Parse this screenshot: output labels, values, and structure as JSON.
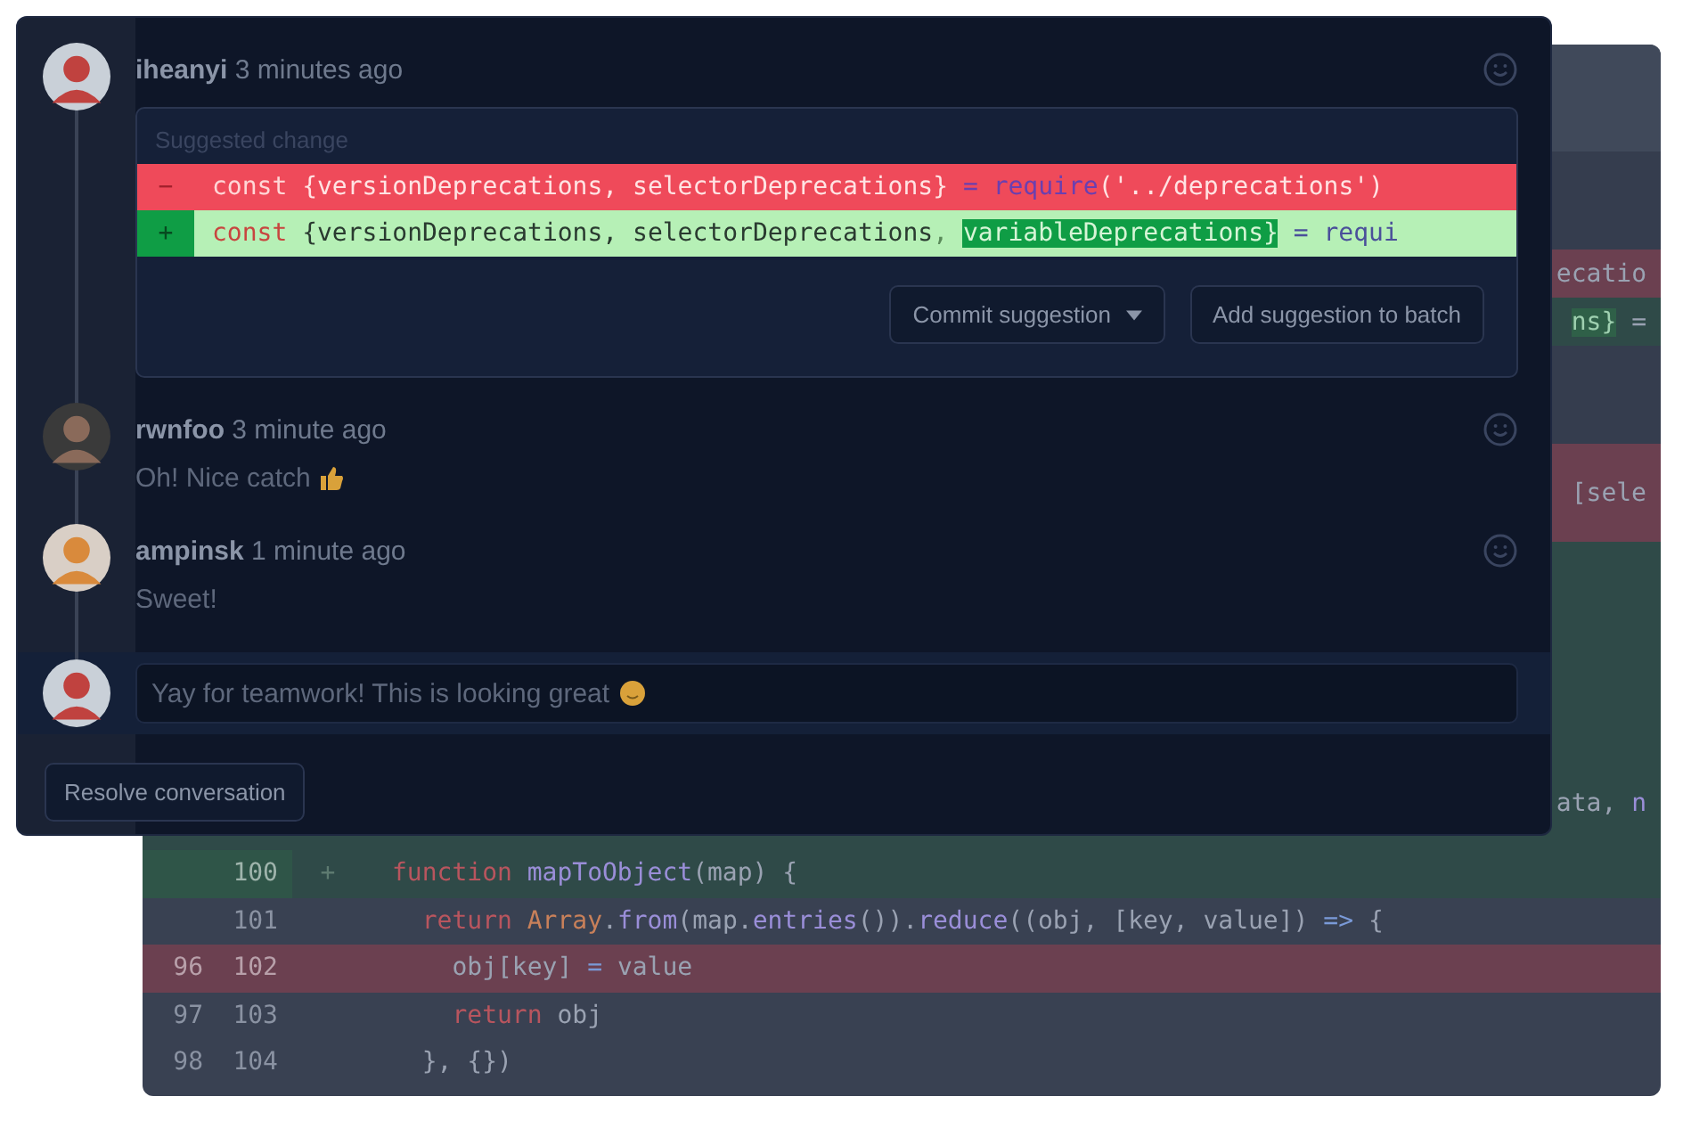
{
  "code_view": {
    "rows": [
      {
        "kind": "head",
        "tokens": []
      },
      {
        "kind": "ctx",
        "tokens": []
      },
      {
        "kind": "del",
        "tokens": [
          {
            "text": "ecatio",
            "kind": "plain"
          }
        ]
      },
      {
        "kind": "add",
        "tokens": [
          {
            "text": "ns}",
            "kind": "highlight"
          },
          {
            "text": " =",
            "kind": "plain"
          }
        ]
      },
      {
        "kind": "ctx",
        "tokens": []
      },
      {
        "kind": "del",
        "tokens": [
          {
            "text": "[sele",
            "kind": "plain"
          }
        ]
      },
      {
        "kind": "add",
        "tokens": []
      },
      {
        "kind": "add",
        "tokens": [
          {
            "text": "ata, ",
            "kind": "plain"
          },
          {
            "text": "n",
            "kind": "func"
          }
        ]
      }
    ],
    "lines": [
      {
        "kind": "add",
        "new": "100",
        "sign": "+",
        "tokens": [
          {
            "text": "function ",
            "kind": "keyword"
          },
          {
            "text": "mapToObject",
            "kind": "func"
          },
          {
            "text": "(map) {",
            "kind": "plain"
          }
        ]
      },
      {
        "kind": "ctx",
        "new": "101",
        "tokens": [
          {
            "text": "  return ",
            "kind": "keyword"
          },
          {
            "text": "Array",
            "kind": "const"
          },
          {
            "text": ".",
            "kind": "plain"
          },
          {
            "text": "from",
            "kind": "func"
          },
          {
            "text": "(map.",
            "kind": "plain"
          },
          {
            "text": "entries",
            "kind": "func"
          },
          {
            "text": "()).",
            "kind": "plain"
          },
          {
            "text": "reduce",
            "kind": "func"
          },
          {
            "text": "((obj, [key, value]) ",
            "kind": "plain"
          },
          {
            "text": "=>",
            "kind": "op"
          },
          {
            "text": " {",
            "kind": "plain"
          }
        ]
      },
      {
        "kind": "del",
        "old": "96",
        "new": "102",
        "tokens": [
          {
            "text": "    obj[key] ",
            "kind": "plain"
          },
          {
            "text": "=",
            "kind": "op"
          },
          {
            "text": " value",
            "kind": "plain"
          }
        ]
      },
      {
        "kind": "ctx",
        "old": "97",
        "new": "103",
        "tokens": [
          {
            "text": "    return ",
            "kind": "keyword"
          },
          {
            "text": "obj",
            "kind": "plain"
          }
        ]
      },
      {
        "kind": "ctx",
        "old": "98",
        "new": "104",
        "tokens": [
          {
            "text": "  }, {})",
            "kind": "plain"
          }
        ]
      }
    ]
  },
  "conversation": {
    "comments": [
      {
        "author": "iheanyi",
        "time": "3 minutes ago",
        "suggestion": {
          "title": "Suggested change",
          "lines": [
            {
              "kind": "del",
              "sign": "−",
              "tokens": [
                {
                  "text": "const ",
                  "kind": "keyword"
                },
                {
                  "text": "{versionDeprecations, selectorDeprecations} ",
                  "kind": "plain"
                },
                {
                  "text": "= ",
                  "kind": "op"
                },
                {
                  "text": "require",
                  "kind": "func"
                },
                {
                  "text": "('../deprecations')",
                  "kind": "plain"
                }
              ]
            },
            {
              "kind": "add",
              "sign": "+",
              "tokens": [
                {
                  "text": "const ",
                  "kind": "keyword"
                },
                {
                  "text": "{versionDeprecations, selectorDeprecations",
                  "kind": "plain"
                },
                {
                  "text": ", ",
                  "kind": "faint"
                },
                {
                  "text": "variableDeprecations}",
                  "kind": "highlight"
                },
                {
                  "text": " = requi",
                  "kind": "op"
                }
              ]
            }
          ],
          "buttons": [
            {
              "label": "Commit suggestion",
              "dropdown": true
            },
            {
              "label": "Add suggestion to batch",
              "dropdown": false
            }
          ]
        }
      },
      {
        "author": "rwnfoo",
        "time": "3 minute ago",
        "body": "Oh! Nice catch",
        "has_emoji": true
      },
      {
        "author": "ampinsk",
        "time": "1 minute ago",
        "body": "Sweet!"
      }
    ],
    "reply": {
      "value": "Yay for teamwork! This is looking great",
      "has_emoji": true
    },
    "resolve_button": "Resolve conversation"
  }
}
